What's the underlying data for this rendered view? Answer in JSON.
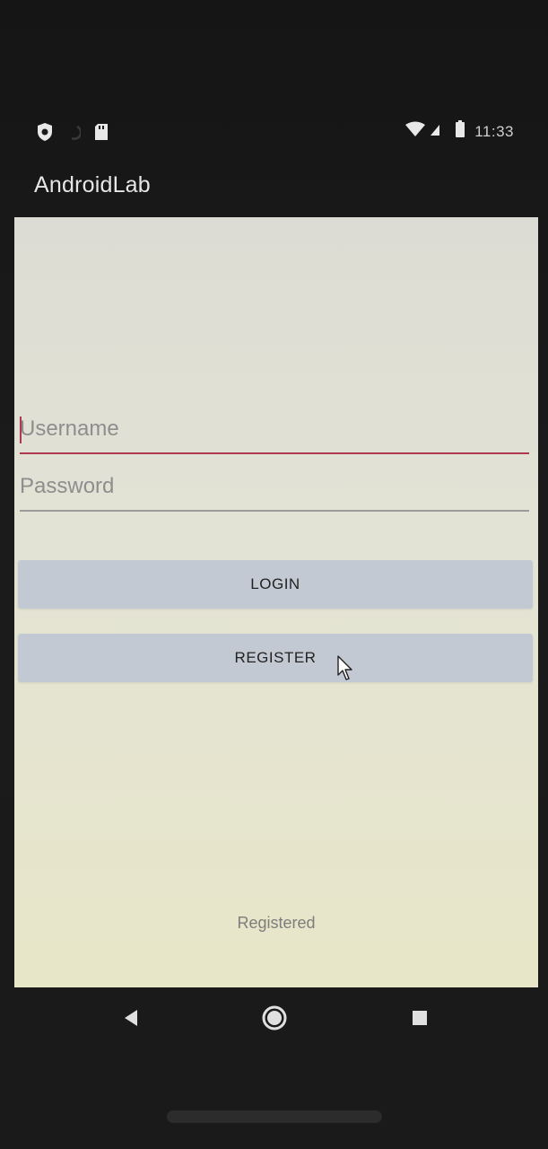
{
  "status_bar": {
    "time": "11:33",
    "left_icons": [
      "shield-icon",
      "sync-icon",
      "sd-card-icon"
    ],
    "right_icons": [
      "wifi-icon",
      "signal-icon",
      "battery-icon"
    ]
  },
  "app_bar": {
    "title": "AndroidLab"
  },
  "form": {
    "username": {
      "value": "",
      "placeholder": "Username",
      "focused": true,
      "accent_color": "#b0384f"
    },
    "password": {
      "value": "",
      "placeholder": "Password"
    },
    "login_label": "LOGIN",
    "register_label": "REGISTER",
    "button_color": "#c3c9d2"
  },
  "status_message": "Registered",
  "nav_bar": {
    "icons": [
      "back-icon",
      "home-icon",
      "recents-icon"
    ]
  }
}
